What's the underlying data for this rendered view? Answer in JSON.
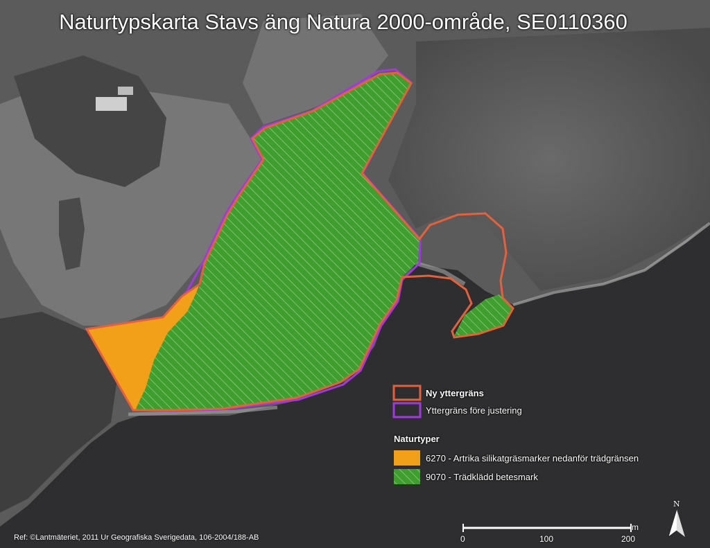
{
  "title": "Naturtypskarta Stavs äng Natura 2000-område, SE0110360",
  "colors": {
    "new_boundary": "#e8603a",
    "old_boundary": "#a238e0",
    "type_6270": "#f2a019",
    "type_9070": "#3f9f2e"
  },
  "legend": {
    "boundaries": [
      {
        "label": "Ny yttergräns"
      },
      {
        "label": "Yttergräns före justering"
      }
    ],
    "naturtyper_heading": "Naturtyper",
    "naturtyper": [
      {
        "label": "6270 - Artrika silikatgräsmarker nedanför trädgränsen"
      },
      {
        "label": "9070 - Trädklädd betesmark"
      }
    ]
  },
  "scale_bar": {
    "unit": "m",
    "ticks": [
      "0",
      "100",
      "200"
    ]
  },
  "north_arrow": {
    "label": "N"
  },
  "credit": "Ref: ©Lantmäteriet, 2011 Ur Geografiska Sverigedata, 106-2004/188-AB"
}
